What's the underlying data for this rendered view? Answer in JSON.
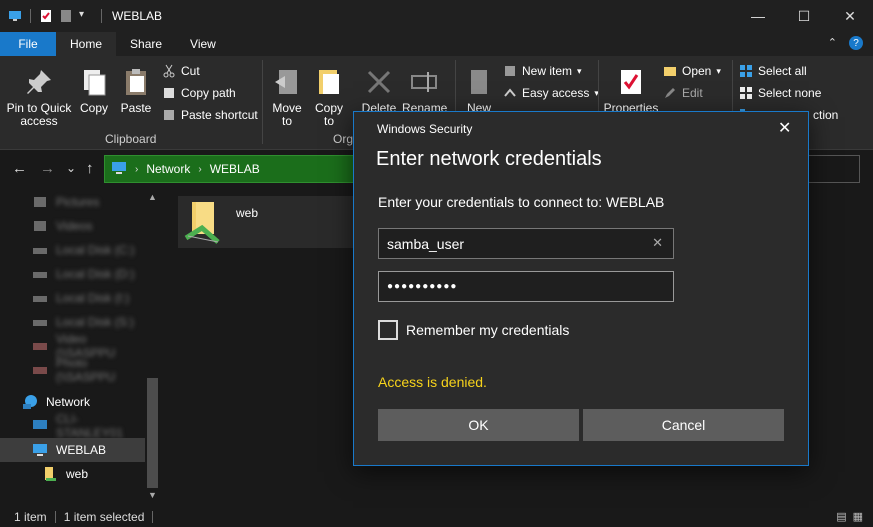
{
  "window": {
    "title": "WEBLAB",
    "minimize": "—",
    "maximize": "☐",
    "close": "✕"
  },
  "ribbon_tabs": {
    "file": "File",
    "home": "Home",
    "share": "Share",
    "view": "View",
    "collapse": "⌃",
    "help": "?"
  },
  "clipboard": {
    "pin": "Pin to Quick access",
    "copy": "Copy",
    "paste": "Paste",
    "cut": "Cut",
    "copy_path": "Copy path",
    "paste_shortcut": "Paste shortcut",
    "group_label": "Clipboard"
  },
  "organize": {
    "move_to": "Move to",
    "copy_to": "Copy to",
    "delete": "Delete",
    "rename": "Rename",
    "group_label": "Org",
    "dropdown": "▾"
  },
  "new_group": {
    "new_folder": "New",
    "new_item": "New item",
    "easy_access": "Easy access"
  },
  "open_group": {
    "properties": "Properties",
    "open": "Open",
    "edit": "Edit"
  },
  "select_group": {
    "select_all": "Select all",
    "select_none": "Select none",
    "invert": "ction"
  },
  "address": {
    "back": "←",
    "forward": "→",
    "recent": "⌄",
    "up": "↑",
    "segments": [
      "Network",
      "WEBLAB"
    ],
    "chevron": "›"
  },
  "nav_pane": {
    "items": [
      {
        "label": "Pictures",
        "blurred": true
      },
      {
        "label": "Videos",
        "blurred": true
      },
      {
        "label": "Local Disk (C:)",
        "blurred": true
      },
      {
        "label": "Local Disk (D:)",
        "blurred": true
      },
      {
        "label": "Local Disk (I:)",
        "blurred": true
      },
      {
        "label": "Local Disk (S:)",
        "blurred": true
      },
      {
        "label": "Video (\\\\SASPPU",
        "blurred": true
      },
      {
        "label": "Photo (\\\\SASPPU",
        "blurred": true
      },
      {
        "label": "Network",
        "blurred": false
      },
      {
        "label": "CLI-STANLEY01",
        "blurred": true
      },
      {
        "label": "WEBLAB",
        "blurred": false
      },
      {
        "label": "web",
        "blurred": false
      }
    ]
  },
  "content": {
    "file_name": "web"
  },
  "status": {
    "item_count": "1 item",
    "selected": "1 item selected"
  },
  "dialog": {
    "caption": "Windows Security",
    "close": "✕",
    "title": "Enter network credentials",
    "prompt": "Enter your credentials to connect to: WEBLAB",
    "username_value": "samba_user",
    "password_value": "●●●●●●●●●●",
    "clear": "✕",
    "remember_label": "Remember my credentials",
    "error": "Access is denied.",
    "ok": "OK",
    "cancel": "Cancel"
  },
  "colors": {
    "accent": "#1979ca",
    "address_green": "#1b6e1b",
    "error_yellow": "#f7d31b",
    "dialog_bg": "#2b2b2b",
    "button_gray": "#5d5d5d"
  }
}
